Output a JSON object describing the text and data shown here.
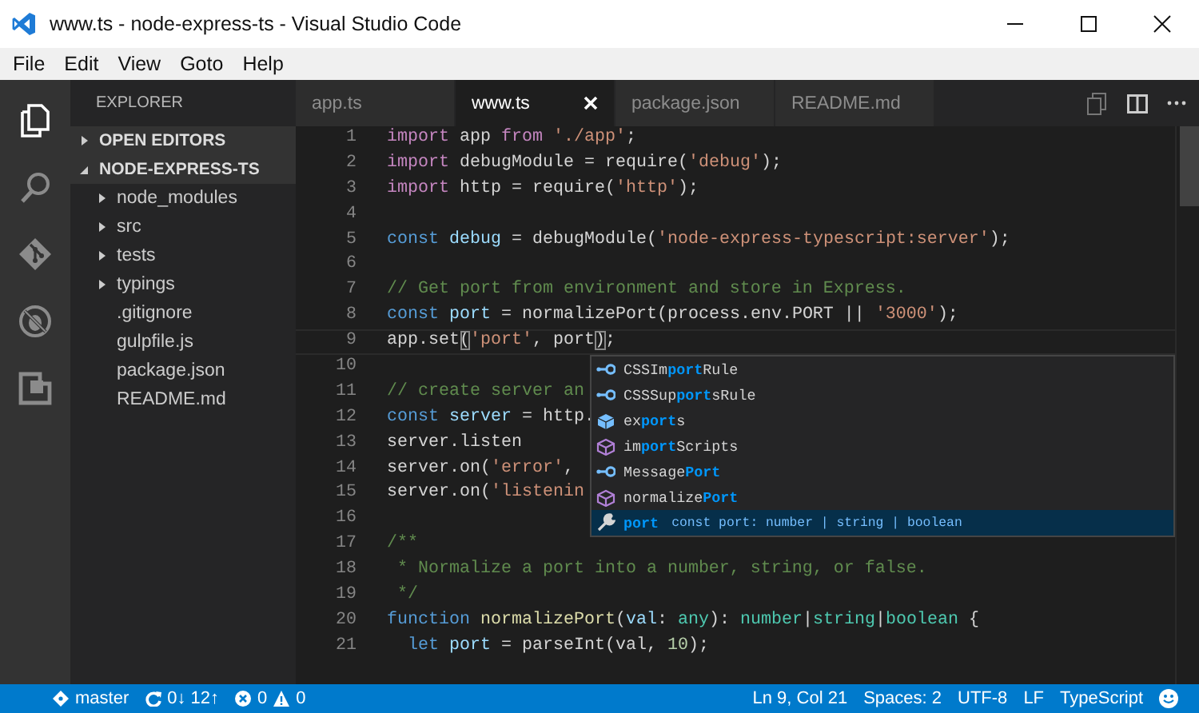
{
  "window": {
    "title": "www.ts - node-express-ts - Visual Studio Code"
  },
  "menu": [
    "File",
    "Edit",
    "View",
    "Goto",
    "Help"
  ],
  "activity_bar": [
    {
      "kind": "files",
      "selected": true
    },
    {
      "kind": "search",
      "selected": false
    },
    {
      "kind": "git",
      "selected": false
    },
    {
      "kind": "debug",
      "selected": false
    },
    {
      "kind": "extensions",
      "selected": false
    }
  ],
  "sidebar": {
    "title": "EXPLORER",
    "sections": [
      {
        "label": "OPEN EDITORS",
        "expanded": false
      },
      {
        "label": "NODE-EXPRESS-TS",
        "expanded": true,
        "children": [
          {
            "label": "node_modules",
            "kind": "folder",
            "expanded": false
          },
          {
            "label": "src",
            "kind": "folder",
            "expanded": false
          },
          {
            "label": "tests",
            "kind": "folder",
            "expanded": false
          },
          {
            "label": "typings",
            "kind": "folder",
            "expanded": false
          },
          {
            "label": ".gitignore",
            "kind": "file"
          },
          {
            "label": "gulpfile.js",
            "kind": "file"
          },
          {
            "label": "package.json",
            "kind": "file"
          },
          {
            "label": "README.md",
            "kind": "file"
          }
        ]
      }
    ]
  },
  "tabs": [
    {
      "label": "app.ts",
      "selected": false
    },
    {
      "label": "www.ts",
      "selected": true
    },
    {
      "label": "package.json",
      "selected": false
    },
    {
      "label": "README.md",
      "selected": false
    }
  ],
  "editor": {
    "lines": [
      {
        "number": "1",
        "current": false,
        "tokens": [
          {
            "kind": "keyword2",
            "text": "import"
          },
          {
            "kind": "plain",
            "text": " app "
          },
          {
            "kind": "keyword2",
            "text": "from"
          },
          {
            "kind": "string",
            "text": " './app'"
          },
          {
            "kind": "plain",
            "text": ";"
          }
        ]
      },
      {
        "number": "2",
        "current": false,
        "tokens": [
          {
            "kind": "keyword2",
            "text": "import"
          },
          {
            "kind": "plain",
            "text": " debugModule = require("
          },
          {
            "kind": "string",
            "text": "'debug'"
          },
          {
            "kind": "plain",
            "text": ");"
          }
        ]
      },
      {
        "number": "3",
        "current": false,
        "tokens": [
          {
            "kind": "keyword2",
            "text": "import"
          },
          {
            "kind": "plain",
            "text": " http = require("
          },
          {
            "kind": "string",
            "text": "'http'"
          },
          {
            "kind": "plain",
            "text": ");"
          }
        ]
      },
      {
        "number": "4",
        "current": false
      },
      {
        "number": "5",
        "current": false,
        "tokens": [
          {
            "kind": "keyword",
            "text": "const"
          },
          {
            "kind": "variable",
            "text": " debug"
          },
          {
            "kind": "plain",
            "text": " = debugModule("
          },
          {
            "kind": "string",
            "text": "'node-express-typescript:server'"
          },
          {
            "kind": "plain",
            "text": ");"
          }
        ]
      },
      {
        "number": "6",
        "current": false
      },
      {
        "number": "7",
        "current": false,
        "tokens": [
          {
            "kind": "comment",
            "text": "// Get port from environment and store in Express."
          }
        ]
      },
      {
        "number": "8",
        "current": false,
        "tokens": [
          {
            "kind": "keyword",
            "text": "const"
          },
          {
            "kind": "variable",
            "text": " port"
          },
          {
            "kind": "plain",
            "text": " = normalizePort(process.env.PORT || "
          },
          {
            "kind": "string",
            "text": "'3000'"
          },
          {
            "kind": "plain",
            "text": ");"
          }
        ]
      },
      {
        "number": "9",
        "current": true,
        "tokens": [
          {
            "kind": "plain",
            "text": "app.set"
          },
          {
            "kind": "bracket",
            "text": "("
          },
          {
            "kind": "string",
            "text": "'port'"
          },
          {
            "kind": "plain",
            "text": ", port"
          },
          {
            "kind": "bracket",
            "text": ")"
          },
          {
            "kind": "plain",
            "text": ";"
          }
        ]
      },
      {
        "number": "10",
        "current": false
      },
      {
        "number": "11",
        "current": false,
        "tokens": [
          {
            "kind": "comment",
            "text": "// create server an"
          }
        ]
      },
      {
        "number": "12",
        "current": false,
        "tokens": [
          {
            "kind": "keyword",
            "text": "const"
          },
          {
            "kind": "variable",
            "text": " server"
          },
          {
            "kind": "plain",
            "text": " = http."
          }
        ]
      },
      {
        "number": "13",
        "current": false,
        "tokens": [
          {
            "kind": "plain",
            "text": "server.listen"
          }
        ]
      },
      {
        "number": "14",
        "current": false,
        "tokens": [
          {
            "kind": "plain",
            "text": "server.on("
          },
          {
            "kind": "string",
            "text": "'error'"
          },
          {
            "kind": "plain",
            "text": ","
          }
        ]
      },
      {
        "number": "15",
        "current": false,
        "tokens": [
          {
            "kind": "plain",
            "text": "server.on("
          },
          {
            "kind": "string",
            "text": "'listenin"
          }
        ]
      },
      {
        "number": "16",
        "current": false
      },
      {
        "number": "17",
        "current": false,
        "tokens": [
          {
            "kind": "comment",
            "text": "/**"
          }
        ]
      },
      {
        "number": "18",
        "current": false,
        "tokens": [
          {
            "kind": "comment",
            "text": " * Normalize a port into a number, string, or false."
          }
        ]
      },
      {
        "number": "19",
        "current": false,
        "tokens": [
          {
            "kind": "comment",
            "text": " */"
          }
        ]
      },
      {
        "number": "20",
        "current": false,
        "tokens": [
          {
            "kind": "keyword",
            "text": "function"
          },
          {
            "kind": "function",
            "text": " normalizePort"
          },
          {
            "kind": "plain",
            "text": "("
          },
          {
            "kind": "variable",
            "text": "val"
          },
          {
            "kind": "plain",
            "text": ": "
          },
          {
            "kind": "type",
            "text": "any"
          },
          {
            "kind": "plain",
            "text": "): "
          },
          {
            "kind": "type",
            "text": "number"
          },
          {
            "kind": "plain",
            "text": "|"
          },
          {
            "kind": "type",
            "text": "string"
          },
          {
            "kind": "plain",
            "text": "|"
          },
          {
            "kind": "type",
            "text": "boolean"
          },
          {
            "kind": "plain",
            "text": " {"
          }
        ]
      },
      {
        "number": "21",
        "current": false,
        "tokens": [
          {
            "kind": "keyword",
            "text": "  let"
          },
          {
            "kind": "variable",
            "text": " port"
          },
          {
            "kind": "plain",
            "text": " = parseInt(val, "
          },
          {
            "kind": "number",
            "text": "10"
          },
          {
            "kind": "plain",
            "text": ");"
          }
        ]
      }
    ],
    "suggestions": [
      {
        "kind": "interface",
        "selected": false,
        "label": [
          {
            "text": "CSSIm",
            "match": false
          },
          {
            "text": "port",
            "match": true
          },
          {
            "text": "Rule",
            "match": false
          }
        ]
      },
      {
        "kind": "interface",
        "selected": false,
        "label": [
          {
            "text": "CSSSup",
            "match": false
          },
          {
            "text": "port",
            "match": true
          },
          {
            "text": "sRule",
            "match": false
          }
        ]
      },
      {
        "kind": "module",
        "selected": false,
        "label": [
          {
            "text": "ex",
            "match": false
          },
          {
            "text": "port",
            "match": true
          },
          {
            "text": "s",
            "match": false
          }
        ]
      },
      {
        "kind": "method",
        "selected": false,
        "label": [
          {
            "text": "im",
            "match": false
          },
          {
            "text": "port",
            "match": true
          },
          {
            "text": "Scripts",
            "match": false
          }
        ]
      },
      {
        "kind": "interface",
        "selected": false,
        "label": [
          {
            "text": "Message",
            "match": false
          },
          {
            "text": "Port",
            "match": true
          }
        ]
      },
      {
        "kind": "method",
        "selected": false,
        "label": [
          {
            "text": "normalize",
            "match": false
          },
          {
            "text": "Port",
            "match": true
          }
        ]
      },
      {
        "kind": "variable",
        "selected": true,
        "label": [
          {
            "text": "port",
            "match": true
          }
        ],
        "detail": "const port: number | string | boolean"
      }
    ]
  },
  "status_bar": {
    "branch": "master",
    "sync": "0↓ 12↑",
    "errors": "0",
    "warnings": "0",
    "position": "Ln 9, Col 21",
    "indent": "Spaces: 2",
    "encoding": "UTF-8",
    "eol": "LF",
    "language": "TypeScript"
  }
}
